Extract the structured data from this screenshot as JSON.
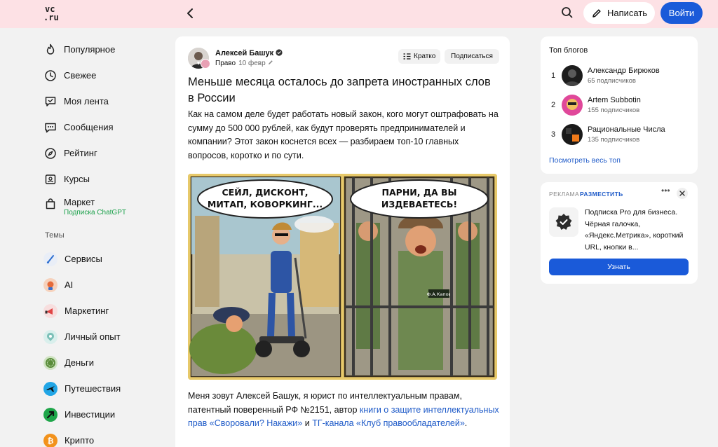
{
  "header": {
    "logo_text": "vc.ru",
    "write_label": "Написать",
    "login_label": "Войти",
    "icons": [
      "back-icon",
      "search-icon",
      "pen-icon"
    ]
  },
  "sidebar": {
    "items": [
      {
        "label": "Популярное",
        "icon": "flame-icon"
      },
      {
        "label": "Свежее",
        "icon": "clock-icon"
      },
      {
        "label": "Моя лента",
        "icon": "feed-icon"
      },
      {
        "label": "Сообщения",
        "icon": "chat-icon"
      },
      {
        "label": "Рейтинг",
        "icon": "compass-icon"
      },
      {
        "label": "Курсы",
        "icon": "course-icon"
      }
    ],
    "market": {
      "label": "Маркет",
      "sublabel": "Подписка ChatGPT",
      "icon": "bag-icon"
    },
    "themes_title": "Темы",
    "themes": [
      {
        "label": "Сервисы",
        "color": "#2d6fd0"
      },
      {
        "label": "AI",
        "color": "#e56a3a"
      },
      {
        "label": "Маркетинг",
        "color": "#e04545"
      },
      {
        "label": "Личный опыт",
        "color": "#7cc0b8"
      },
      {
        "label": "Деньги",
        "color": "#5a8d3a"
      },
      {
        "label": "Путешествия",
        "color": "#22a6e6"
      },
      {
        "label": "Инвестиции",
        "color": "#1fa64a"
      },
      {
        "label": "Крипто",
        "color": "#f2921c"
      }
    ]
  },
  "article": {
    "author": "Алексей Башук",
    "category": "Право",
    "date": "10 февр",
    "brief_label": "Кратко",
    "subscribe_label": "Подписаться",
    "title": "Меньше месяца осталось до запрета иностранных слов в России",
    "lead": "Как на самом деле будет работать новый закон, кого могут оштрафовать на сумму до 500 000 рублей, как будут проверять предпринимателей и компании? Этот закон коснется всех — разбираем топ-10 главных вопросов, коротко и по сути.",
    "image": {
      "left_bubble": "СЕЙЛ, ДИСКОНТ, МИТАП, КОВОРКИНГ...",
      "right_bubble": "ПАРНИ, ДА ВЫ ИЗДЕВАЕТЕСЬ!",
      "name_tag": "Ф.А.Капов"
    },
    "body_prefix": "Меня зовут Алексей Башук, я юрист по интеллектуальным правам, патентный поверенный РФ №2151, автор ",
    "body_link1": "книги о защите интеллектуальных прав «Своровали? Накажи»",
    "body_middle": " и ",
    "body_link2": "ТГ-канала «Клуб правообладателей»",
    "body_suffix": "."
  },
  "top_blogs": {
    "title": "Топ блогов",
    "items": [
      {
        "rank": "1",
        "name": "Александр Бирюков",
        "subs": "65 подписчиков"
      },
      {
        "rank": "2",
        "name": "Artem Subbotin",
        "subs": "155 подписчиков"
      },
      {
        "rank": "3",
        "name": "Рациональные Числа",
        "subs": "135 подписчиков"
      }
    ],
    "see_all": "Посмотреть весь топ"
  },
  "ad": {
    "label": "РЕКЛАМА",
    "place": "РАЗМЕСТИТЬ",
    "more": "•••",
    "text": "Подписка Pro для бизнеса. Чёрная галочка, «Яндекс.Метрика», короткий URL, кнопки в...",
    "button": "Узнать"
  },
  "colors": {
    "header_bg": "#fde1e5",
    "accent": "#1a5ad9",
    "link": "#1e5ac8",
    "market_sub": "#1aa04a"
  }
}
